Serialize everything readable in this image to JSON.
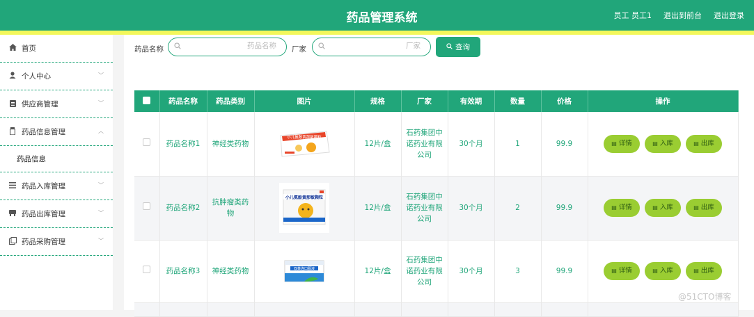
{
  "header": {
    "title": "药品管理系统",
    "user_label": "员工 员工1",
    "back_link": "退出到前台",
    "logout_link": "退出登录"
  },
  "sidebar": {
    "items": [
      {
        "label": "首页",
        "icon": "home-icon",
        "has_chevron": false
      },
      {
        "label": "个人中心",
        "icon": "user-icon",
        "has_chevron": true
      },
      {
        "label": "供应商管理",
        "icon": "clipboard-icon",
        "has_chevron": true
      },
      {
        "label": "药品信息管理",
        "icon": "medicine-icon",
        "has_chevron": true,
        "expanded": true
      },
      {
        "label": "药品入库管理",
        "icon": "list-icon",
        "has_chevron": true
      },
      {
        "label": "药品出库管理",
        "icon": "box-icon",
        "has_chevron": true
      },
      {
        "label": "药品采购管理",
        "icon": "copy-icon",
        "has_chevron": true
      }
    ],
    "sub_item": "药品信息"
  },
  "search": {
    "name_label": "药品名称",
    "name_placeholder": "药品名称",
    "maker_label": "厂家",
    "maker_placeholder": "厂家",
    "query_button": "查询"
  },
  "table": {
    "columns": [
      "药品名称",
      "药品类别",
      "图片",
      "规格",
      "厂家",
      "有效期",
      "数量",
      "价格",
      "操作"
    ],
    "rows": [
      {
        "name": "药品名称1",
        "category": "神经类药物",
        "spec": "12片/盒",
        "maker": "石药集团中诺药业有限公司",
        "validity": "30个月",
        "qty": "1",
        "price": "99.9",
        "image": "小儿氨酚黄那敏颗粒"
      },
      {
        "name": "药品名称2",
        "category": "抗肿瘤类药物",
        "spec": "12片/盒",
        "maker": "石药集团中诺药业有限公司",
        "validity": "30个月",
        "qty": "2",
        "price": "99.9",
        "image": "小儿氨酚黄那敏颗粒"
      },
      {
        "name": "药品名称3",
        "category": "神经类药物",
        "spec": "12片/盒",
        "maker": "石药集团中诺药业有限公司",
        "validity": "30个月",
        "qty": "3",
        "price": "99.9",
        "image": "双黄连口服液"
      }
    ],
    "actions": {
      "detail": "详情",
      "in": "入库",
      "out": "出库"
    }
  },
  "watermark": "@51CTO博客",
  "colors": {
    "primary": "#21a67a",
    "accent_line": "#f3f75b",
    "action_button": "#9acd32"
  }
}
